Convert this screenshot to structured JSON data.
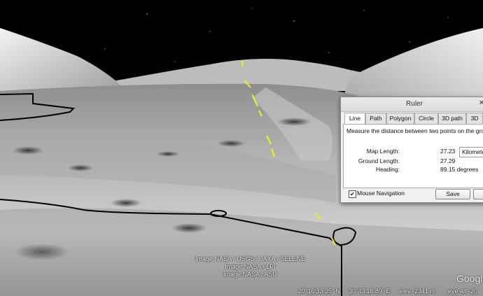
{
  "credits": [
    "Image NASA / USGS / JAXA / SELENE",
    "Image NASA / LPI",
    "Image NASA / ASU"
  ],
  "status": {
    "lat": "20°16'33.35\" N",
    "lon": "30°43'16.89\" E",
    "elev": "elev -2341 m",
    "eye_alt": "eye alt -20"
  },
  "logo": "Google",
  "ruler": {
    "title": "Ruler",
    "close": "✕",
    "tabs": [
      "Line",
      "Path",
      "Polygon",
      "Circle",
      "3D path",
      "3D"
    ],
    "active_tab": "Line",
    "description": "Measure the distance between two points on the ground",
    "map_length_label": "Map Length:",
    "map_length_value": "27.23",
    "unit": "Kilometers",
    "ground_length_label": "Ground Length:",
    "ground_length_value": "27.29",
    "heading_label": "Heading:",
    "heading_value": "89.15 degrees",
    "mouse_nav_label": "Mouse Navigation",
    "mouse_nav_checked": "✔",
    "save_label": "Save"
  },
  "colors": {
    "measure_line": "#f2f21a",
    "path_line": "#000000",
    "sky": "#000000"
  }
}
